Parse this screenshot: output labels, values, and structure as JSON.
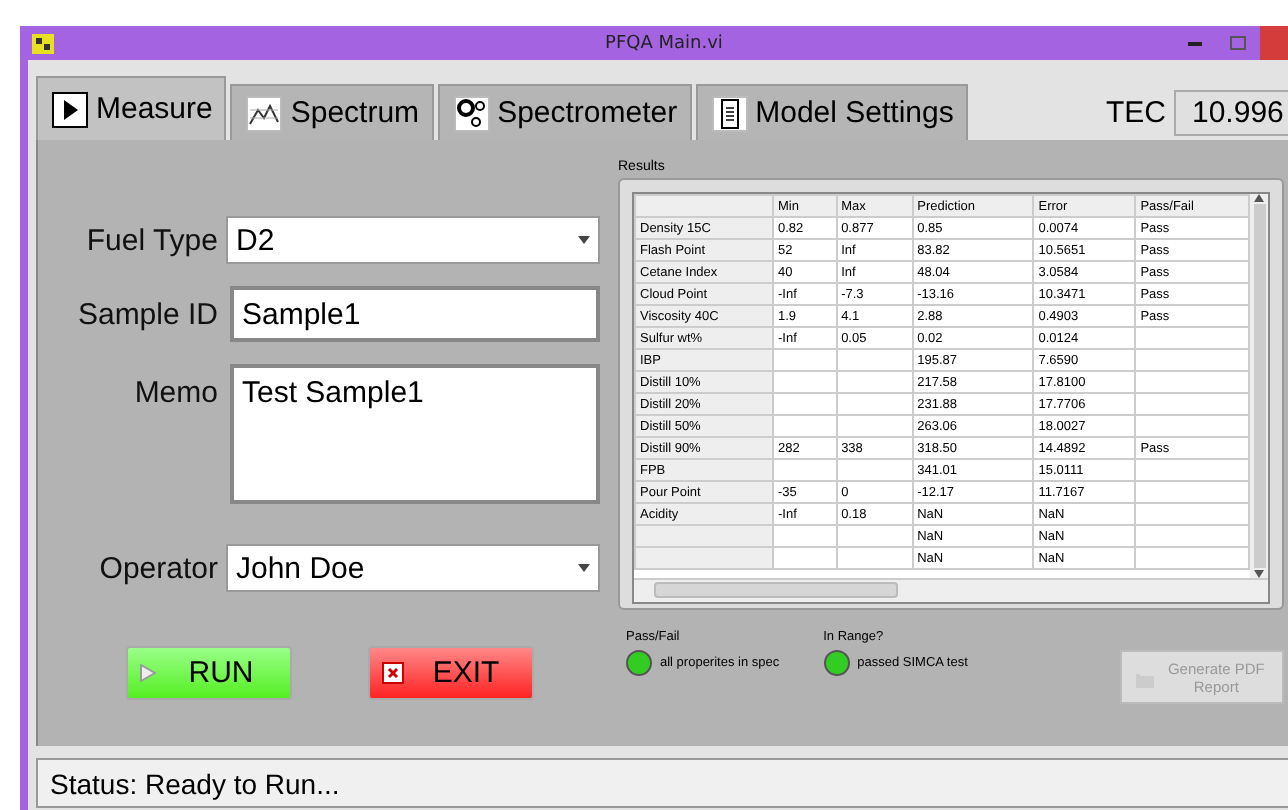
{
  "window": {
    "title": "PFQA Main.vi"
  },
  "tabs": [
    {
      "label": "Measure",
      "selected": true
    },
    {
      "label": "Spectrum",
      "selected": false
    },
    {
      "label": "Spectrometer",
      "selected": false
    },
    {
      "label": "Model Settings",
      "selected": false
    }
  ],
  "tec": {
    "label": "TEC",
    "value": "10.996"
  },
  "form": {
    "fuel_type": {
      "label": "Fuel Type",
      "value": "D2"
    },
    "sample_id": {
      "label": "Sample ID",
      "value": "Sample1"
    },
    "memo": {
      "label": "Memo",
      "value": "Test Sample1"
    },
    "operator": {
      "label": "Operator",
      "value": "John Doe"
    }
  },
  "buttons": [
    {
      "label": "RUN",
      "kind": "run"
    },
    {
      "label": "EXIT",
      "kind": "exit"
    }
  ],
  "results": {
    "title": "Results",
    "columns": [
      "",
      "Min",
      "Max",
      "Prediction",
      "Error",
      "Pass/Fail"
    ],
    "rows": [
      [
        "Density 15C",
        "0.82",
        "0.877",
        "0.85",
        "0.0074",
        "Pass"
      ],
      [
        "Flash Point",
        "52",
        "Inf",
        "83.82",
        "10.5651",
        "Pass"
      ],
      [
        "Cetane Index",
        "40",
        "Inf",
        "48.04",
        "3.0584",
        "Pass"
      ],
      [
        "Cloud Point",
        "-Inf",
        "-7.3",
        "-13.16",
        "10.3471",
        "Pass"
      ],
      [
        "Viscosity 40C",
        "1.9",
        "4.1",
        "2.88",
        "0.4903",
        "Pass"
      ],
      [
        "Sulfur wt%",
        "-Inf",
        "0.05",
        "0.02",
        "0.0124",
        ""
      ],
      [
        "IBP",
        "",
        "",
        "195.87",
        "7.6590",
        ""
      ],
      [
        "Distill 10%",
        "",
        "",
        "217.58",
        "17.8100",
        ""
      ],
      [
        "Distill 20%",
        "",
        "",
        "231.88",
        "17.7706",
        ""
      ],
      [
        "Distill 50%",
        "",
        "",
        "263.06",
        "18.0027",
        ""
      ],
      [
        "Distill 90%",
        "282",
        "338",
        "318.50",
        "14.4892",
        "Pass"
      ],
      [
        "FPB",
        "",
        "",
        "341.01",
        "15.0111",
        ""
      ],
      [
        "Pour Point",
        "-35",
        "0",
        "-12.17",
        "11.7167",
        ""
      ],
      [
        "Acidity",
        "-Inf",
        "0.18",
        "NaN",
        "NaN",
        ""
      ],
      [
        "",
        "",
        "",
        "NaN",
        "NaN",
        ""
      ],
      [
        "",
        "",
        "",
        "NaN",
        "NaN",
        ""
      ]
    ]
  },
  "indicators": [
    {
      "title": "Pass/Fail",
      "label": "all properites in spec",
      "on": true
    },
    {
      "title": "In Range?",
      "label": "passed SIMCA test",
      "on": true
    }
  ],
  "report_button": {
    "label": "Generate PDF Report",
    "disabled": true
  },
  "status_bar": "Status: Ready to Run..."
}
